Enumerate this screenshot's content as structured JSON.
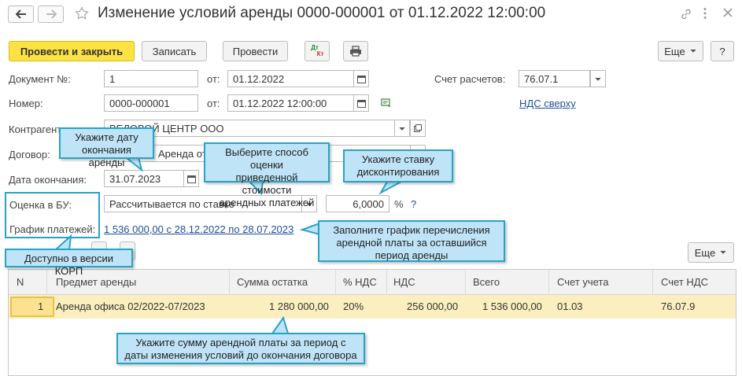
{
  "window": {
    "title": "Изменение условий аренды 0000-000001 от 01.12.2022 12:00:00",
    "icons": [
      "back-arrow-icon",
      "forward-arrow-icon",
      "star-icon",
      "link-icon",
      "more-vertical-icon",
      "close-icon"
    ]
  },
  "toolbar": {
    "post_and_close": "Провести и закрыть",
    "save": "Записать",
    "post": "Провести",
    "dtkt_top": "Дт",
    "dtkt_bottom": "Кт",
    "more": "Еще",
    "help": "?"
  },
  "form": {
    "doc_num_label": "Документ №:",
    "doc_num_value": "1",
    "from_label": "от:",
    "doc_date_value": "01.12.2022",
    "settlement_account_label": "Счет расчетов:",
    "settlement_account_value": "76.07.1",
    "number_label": "Номер:",
    "number_value": "0000-000001",
    "from_label2": "от:",
    "number_date_value": "01.12.2022 12:00:00",
    "vat_link": "НДС сверху",
    "counterparty_label": "Контрагент:",
    "counterparty_value": "ВЕЛОВОЙ ЦЕНТР ООО",
    "contract_label": "Договор:",
    "contract_value": "Аренда от",
    "end_date_label": "Дата окончания:",
    "end_date_value": "31.07.2023",
    "valuation_label": "Оценка в БУ:",
    "valuation_value": "Рассчитывается по ставке",
    "rate_value": "6,0000",
    "rate_unit": "%",
    "rate_help": "?",
    "schedule_label": "График платежей:",
    "schedule_link": "1 536 000,00 с 28.12.2022 по 28.07.2023"
  },
  "table_toolbar": {
    "more": "Еще"
  },
  "table": {
    "columns": [
      "N",
      "Предмет аренды",
      "Сумма остатка",
      "% НДС",
      "НДС",
      "Всего",
      "Счет учета",
      "Счет НДС"
    ],
    "rows": [
      [
        "1",
        "Аренда офиса 02/2022-07/2023",
        "1 280 000,00",
        "20%",
        "256 000,00",
        "1 536 000,00",
        "01.03",
        "76.07.9"
      ]
    ]
  },
  "callouts": {
    "end_date": "Укажите дату\nокончания аренды",
    "valuation": "Выберите способ оценки\nприведенной стоимости\nарендных платежей",
    "rate": "Укажите ставку\nдисконтирования",
    "schedule": "Заполните график перечисления\nарендной платы за оставшийся\nпериод аренды",
    "korp": "Доступно в версии КОРП",
    "sum": "Укажите сумму арендной платы за период с\nдаты изменения условий до окончания договора"
  },
  "colors": {
    "primary_button": "#fce243",
    "callout_fill": "#bfe4f7",
    "callout_border": "#27a4c5",
    "selected_row": "#fbefbf",
    "link": "#1e4f9a"
  }
}
